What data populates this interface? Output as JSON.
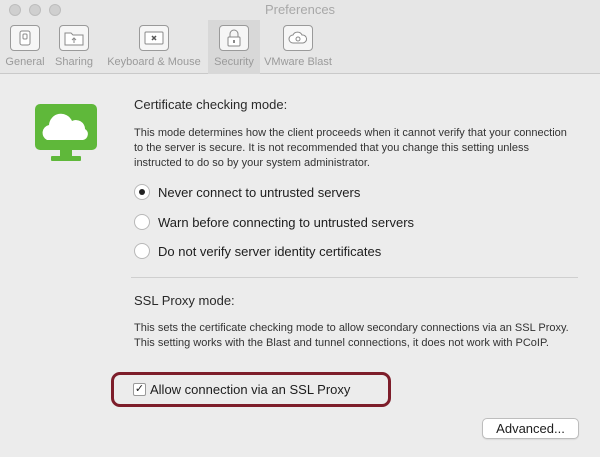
{
  "window": {
    "title": "Preferences"
  },
  "toolbar": {
    "tabs": [
      {
        "label": "General",
        "icon": "general-icon",
        "selected": false
      },
      {
        "label": "Sharing",
        "icon": "sharing-folder-icon",
        "selected": false
      },
      {
        "label": "Keyboard & Mouse",
        "icon": "keyboard-icon",
        "selected": false
      },
      {
        "label": "Security",
        "icon": "lock-icon",
        "selected": true
      },
      {
        "label": "VMware Blast",
        "icon": "cloud-icon",
        "selected": false
      }
    ]
  },
  "certificate": {
    "title": "Certificate checking mode:",
    "description": "This mode determines how the client proceeds when it cannot verify that your connection to the server is secure. It is not recommended that you change this setting unless instructed to do so by your system administrator.",
    "options": [
      {
        "label": "Never connect to untrusted servers",
        "selected": true
      },
      {
        "label": "Warn before connecting to untrusted servers",
        "selected": false
      },
      {
        "label": "Do not verify server identity certificates",
        "selected": false
      }
    ]
  },
  "ssl_proxy": {
    "title": "SSL Proxy mode:",
    "description": "This sets the certificate checking mode to allow secondary connections via an SSL Proxy. This setting works with the Blast and tunnel connections, it does not work with PCoIP.",
    "checkbox_label": "Allow connection via an SSL Proxy",
    "checked": true,
    "check_mark": "✓"
  },
  "buttons": {
    "advanced": "Advanced..."
  },
  "colors": {
    "logo_green": "#5fb83a",
    "highlight_border": "#7d1d2a"
  }
}
